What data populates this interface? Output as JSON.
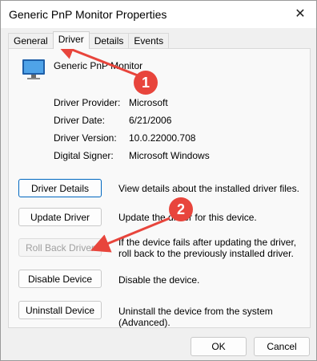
{
  "window": {
    "title": "Generic PnP Monitor Properties",
    "close_glyph": "✕"
  },
  "tabs": [
    {
      "label": "General",
      "active": false
    },
    {
      "label": "Driver",
      "active": true
    },
    {
      "label": "Details",
      "active": false
    },
    {
      "label": "Events",
      "active": false
    }
  ],
  "device": {
    "name": "Generic PnP Monitor",
    "icon": "monitor-icon"
  },
  "properties": [
    {
      "label": "Driver Provider:",
      "value": "Microsoft"
    },
    {
      "label": "Driver Date:",
      "value": "6/21/2006"
    },
    {
      "label": "Driver Version:",
      "value": "10.0.22000.708"
    },
    {
      "label": "Digital Signer:",
      "value": "Microsoft Windows"
    }
  ],
  "actions": [
    {
      "label": "Driver Details",
      "description": "View details about the installed driver files.",
      "enabled": true,
      "focused": true
    },
    {
      "label": "Update Driver",
      "description": "Update the driver for this device.",
      "enabled": true,
      "focused": false
    },
    {
      "label": "Roll Back Driver",
      "description": "If the device fails after updating the driver, roll back to the previously installed driver.",
      "enabled": false,
      "focused": false
    },
    {
      "label": "Disable Device",
      "description": "Disable the device.",
      "enabled": true,
      "focused": false
    },
    {
      "label": "Uninstall Device",
      "description": "Uninstall the device from the system (Advanced).",
      "enabled": true,
      "focused": false
    }
  ],
  "footer": {
    "ok_label": "OK",
    "cancel_label": "Cancel"
  },
  "annotations": [
    {
      "number": "1",
      "color": "#e8453c"
    },
    {
      "number": "2",
      "color": "#e8453c"
    }
  ]
}
